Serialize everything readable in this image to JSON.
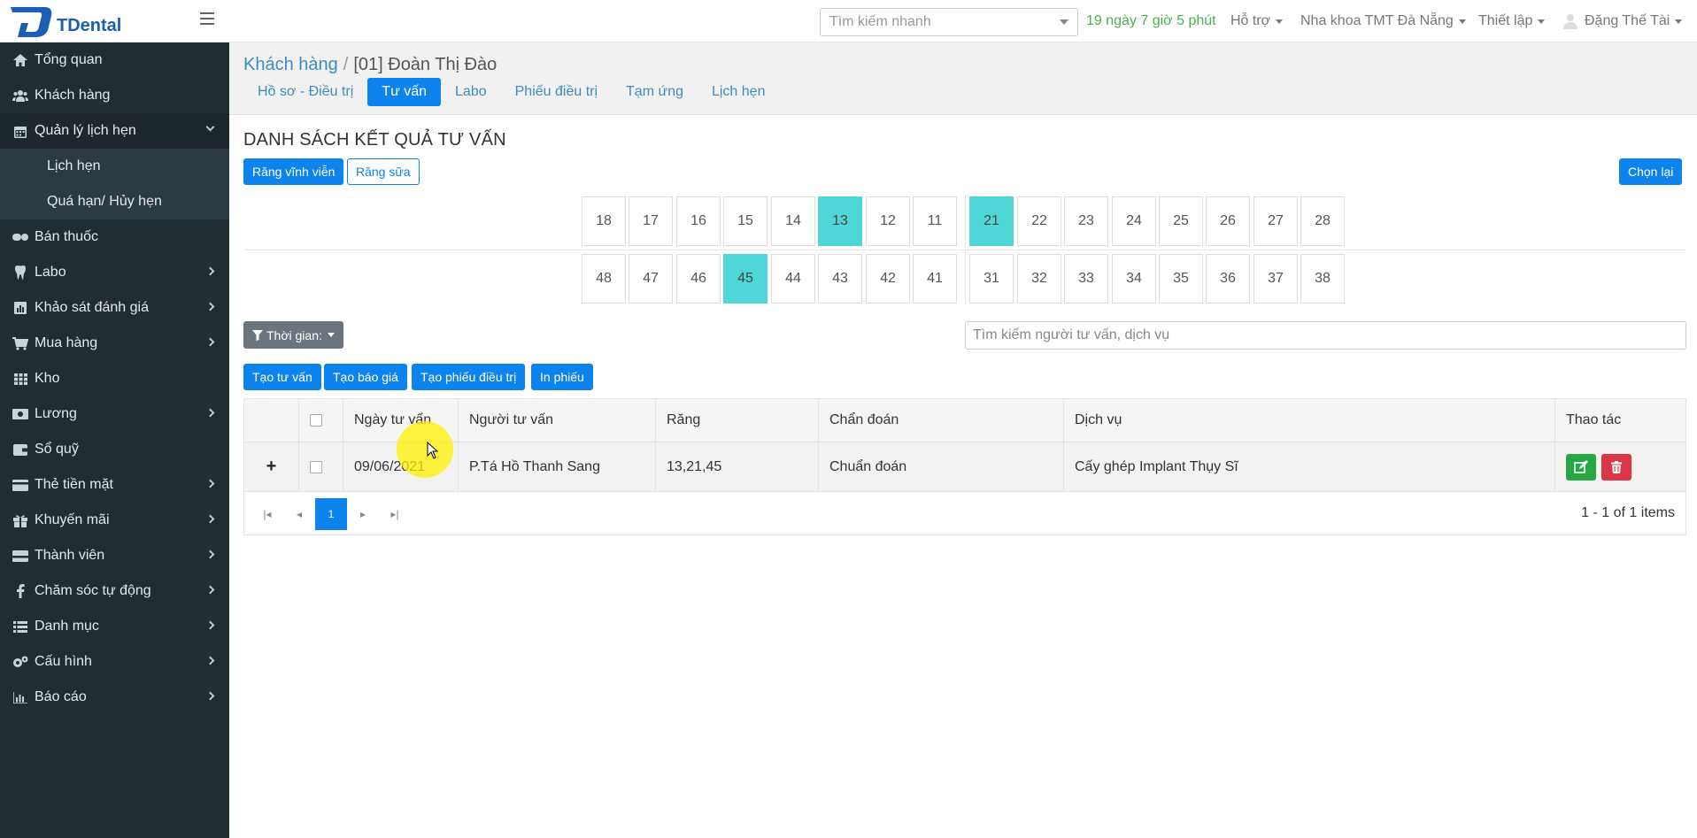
{
  "app": {
    "logo_text": "TDental"
  },
  "topbar": {
    "quick_search_placeholder": "Tìm kiếm nhanh",
    "time_left": "19 ngày 7 giờ 5 phút",
    "support": "Hỗ trợ",
    "clinic": "Nha khoa TMT Đà Nẵng",
    "settings": "Thiết lập",
    "user": "Đặng Thế Tài"
  },
  "sidebar": {
    "items": [
      {
        "label": "Tổng quan",
        "icon": "home-icon"
      },
      {
        "label": "Khách hàng",
        "icon": "users-icon"
      },
      {
        "label": "Quản lý lịch hẹn",
        "icon": "calendar-icon",
        "open": true
      },
      {
        "label": "Bán thuốc",
        "icon": "pills-icon"
      },
      {
        "label": "Labo",
        "icon": "tooth-icon"
      },
      {
        "label": "Khảo sát đánh giá",
        "icon": "chart-icon"
      },
      {
        "label": "Mua hàng",
        "icon": "cart-icon"
      },
      {
        "label": "Kho",
        "icon": "grid-icon"
      },
      {
        "label": "Lương",
        "icon": "money-icon"
      },
      {
        "label": "Sổ quỹ",
        "icon": "wallet-icon"
      },
      {
        "label": "Thẻ tiền mặt",
        "icon": "card-icon"
      },
      {
        "label": "Khuyến mãi",
        "icon": "gift-icon"
      },
      {
        "label": "Thành viên",
        "icon": "member-card-icon"
      },
      {
        "label": "Chăm sóc tự động",
        "icon": "facebook-icon"
      },
      {
        "label": "Danh mục",
        "icon": "list-icon"
      },
      {
        "label": "Cấu hình",
        "icon": "gears-icon"
      },
      {
        "label": "Báo cáo",
        "icon": "bar-chart-icon"
      }
    ],
    "submenu": [
      "Lịch hẹn",
      "Quá hạn/ Hủy hẹn"
    ]
  },
  "header": {
    "breadcrumb_root": "Khách hàng",
    "breadcrumb_sep": "/",
    "breadcrumb_current": "[01] Đoàn Thị Đào",
    "tabs": [
      "Hồ sơ - Điều trị",
      "Tư vấn",
      "Labo",
      "Phiếu điều trị",
      "Tạm ứng",
      "Lịch hẹn"
    ],
    "active_tab": "Tư vấn"
  },
  "main": {
    "title": "DANH SÁCH KẾT QUẢ TƯ VẤN",
    "btn_permanent": "Răng vĩnh viễn",
    "btn_milk": "Răng sữa",
    "btn_reset": "Chọn lại",
    "teeth_upper": [
      "18",
      "17",
      "16",
      "15",
      "14",
      "13",
      "12",
      "11",
      "21",
      "22",
      "23",
      "24",
      "25",
      "26",
      "27",
      "28"
    ],
    "teeth_lower": [
      "48",
      "47",
      "46",
      "45",
      "44",
      "43",
      "42",
      "41",
      "31",
      "32",
      "33",
      "34",
      "35",
      "36",
      "37",
      "38"
    ],
    "selected_teeth": [
      "13",
      "21",
      "45"
    ],
    "time_filter": "Thời gian:",
    "search_placeholder": "Tìm kiếm người tư vấn, dịch vụ",
    "actions": [
      "Tạo tư vấn",
      "Tạo báo giá",
      "Tạo phiếu điều trị",
      "In phiếu"
    ]
  },
  "table": {
    "columns": [
      "Ngày tư vấn",
      "Người tư vấn",
      "Răng",
      "Chẩn đoán",
      "Dịch vụ",
      "Thao tác"
    ],
    "rows": [
      {
        "expand": "+",
        "date": "09/06/2021",
        "consultant": "P.Tá Hồ Thanh Sang",
        "teeth": "13,21,45",
        "diagnosis": "Chuẩn đoán",
        "service": "Cấy ghép Implant Thụy Sĩ"
      }
    ],
    "page": "1",
    "info": "1 - 1 of 1 items"
  }
}
